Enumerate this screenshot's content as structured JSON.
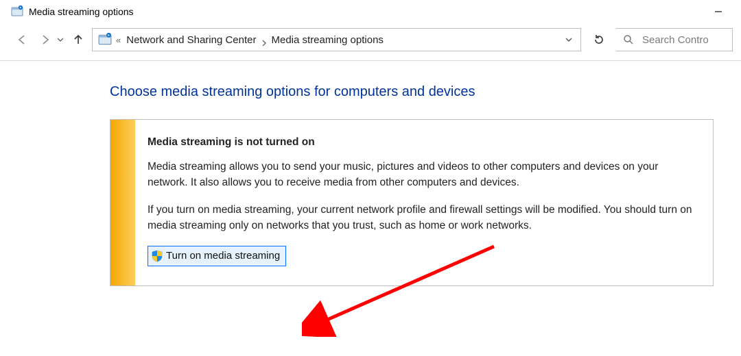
{
  "window": {
    "title": "Media streaming options",
    "minimize_label": "Minimize"
  },
  "nav": {
    "back_label": "Back",
    "forward_label": "Forward",
    "recent_label": "Recent locations",
    "up_label": "Up"
  },
  "breadcrumbs": {
    "overflow_indicator": "«",
    "item1": "Network and Sharing Center",
    "item2": "Media streaming options",
    "dropdown_label": "Previous locations",
    "refresh_label": "Refresh"
  },
  "search": {
    "placeholder": "Search Contro"
  },
  "page": {
    "heading": "Choose media streaming options for computers and devices"
  },
  "notice": {
    "title": "Media streaming is not turned on",
    "para1": "Media streaming allows you to send your music, pictures and videos to other computers and devices on your network.  It also allows you to receive media from other computers and devices.",
    "para2": "If you turn on media streaming, your current network profile and firewall settings will be modified. You should turn on media streaming only on networks that you trust, such as home or work networks.",
    "button_label": "Turn on media streaming"
  }
}
